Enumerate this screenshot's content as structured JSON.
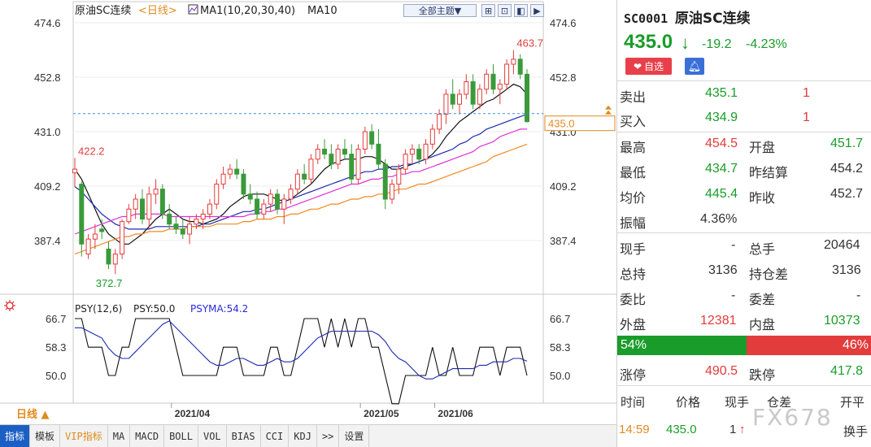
{
  "chart": {
    "title": "原油SC连续",
    "period_tag": "<日线>",
    "ma_legend": "MA1(10,20,30,40)",
    "ma_legend2": "MA10",
    "theme_button": "全部主题▼",
    "price_ticks": [
      "474.6",
      "452.8",
      "431.0",
      "409.2",
      "387.4"
    ],
    "high_annotation": "463.7",
    "low_annotation": "372.7",
    "left_annotation": "422.2",
    "current_price_label": "435.0",
    "date_labels": [
      "2021/04",
      "2021/05",
      "2021/06"
    ],
    "psy_title": "PSY(12,6)",
    "psy_value": "PSY:50.0",
    "psyma_value": "PSYMA:54.2",
    "psy_ticks": [
      "66.7",
      "58.3",
      "50.0"
    ],
    "period_button": "日线 ▲"
  },
  "chart_data": {
    "type": "candlestick",
    "candles": [
      [
        414.5,
        420.5,
        409,
        416
      ],
      [
        410,
        411,
        381,
        386
      ],
      [
        382,
        390,
        380,
        388
      ],
      [
        388,
        394,
        384,
        390
      ],
      [
        392,
        396,
        388,
        391
      ],
      [
        384,
        387,
        376,
        378
      ],
      [
        378,
        384,
        374,
        382
      ],
      [
        382,
        396,
        380,
        395
      ],
      [
        395,
        402,
        394,
        400
      ],
      [
        400,
        406,
        396,
        404
      ],
      [
        404,
        408,
        394,
        396
      ],
      [
        396,
        409,
        392,
        406
      ],
      [
        406,
        412,
        402,
        408
      ],
      [
        408,
        410,
        396,
        398
      ],
      [
        398,
        402,
        392,
        394
      ],
      [
        394,
        397,
        390,
        392
      ],
      [
        392,
        396,
        388,
        390
      ],
      [
        390,
        397,
        386,
        394
      ],
      [
        394,
        398,
        392,
        396
      ],
      [
        396,
        400,
        392,
        398
      ],
      [
        398,
        404,
        396,
        402
      ],
      [
        402,
        412,
        400,
        410
      ],
      [
        410,
        417,
        408,
        414
      ],
      [
        414,
        418,
        412,
        416
      ],
      [
        416,
        420,
        412,
        414
      ],
      [
        414,
        416,
        404,
        406
      ],
      [
        406,
        410,
        402,
        404
      ],
      [
        404,
        407,
        396,
        398
      ],
      [
        398,
        404,
        396,
        402
      ],
      [
        402,
        408,
        399,
        406
      ],
      [
        406,
        408,
        398,
        400
      ],
      [
        400,
        406,
        394,
        404
      ],
      [
        404,
        410,
        402,
        408
      ],
      [
        408,
        416,
        406,
        414
      ],
      [
        414,
        418,
        410,
        412
      ],
      [
        412,
        422,
        410,
        420
      ],
      [
        420,
        426,
        418,
        424
      ],
      [
        424,
        428,
        420,
        422
      ],
      [
        422,
        426,
        416,
        418
      ],
      [
        418,
        426,
        416,
        424
      ],
      [
        424,
        428,
        420,
        422
      ],
      [
        422,
        426,
        410,
        412
      ],
      [
        412,
        426,
        410,
        424
      ],
      [
        424,
        433,
        422,
        431
      ],
      [
        431,
        434,
        424,
        426
      ],
      [
        426,
        432,
        416,
        418
      ],
      [
        418,
        420,
        400,
        404
      ],
      [
        404,
        412,
        402,
        410
      ],
      [
        410,
        418,
        406,
        416
      ],
      [
        416,
        424,
        414,
        422
      ],
      [
        422,
        426,
        418,
        424
      ],
      [
        424,
        426,
        418,
        420
      ],
      [
        420,
        428,
        418,
        426
      ],
      [
        426,
        434,
        424,
        432
      ],
      [
        432,
        440,
        430,
        438
      ],
      [
        438,
        448,
        434,
        446
      ],
      [
        446,
        452,
        440,
        442
      ],
      [
        442,
        448,
        438,
        446
      ],
      [
        446,
        454,
        444,
        451
      ],
      [
        451,
        454,
        440,
        442
      ],
      [
        442,
        450,
        440,
        448
      ],
      [
        448,
        456,
        446,
        454
      ],
      [
        454,
        458,
        446,
        448
      ],
      [
        448,
        452,
        442,
        450
      ],
      [
        450,
        460,
        448,
        458
      ],
      [
        458,
        463.7,
        454,
        460
      ],
      [
        460,
        462,
        452,
        454
      ],
      [
        454,
        456,
        434.7,
        435
      ]
    ],
    "ma_lines": {
      "ma10": [
        416,
        412,
        406,
        400,
        394,
        390,
        388,
        386,
        386,
        388,
        390,
        393,
        396,
        398,
        400,
        398,
        396,
        395,
        395,
        394,
        395,
        396,
        398,
        401,
        403,
        405,
        406,
        406,
        406,
        405,
        404,
        403,
        404,
        406,
        408,
        410,
        413,
        416,
        418,
        419,
        420,
        420,
        420,
        421,
        421,
        420,
        418,
        416,
        416,
        417,
        418,
        419,
        420,
        422,
        425,
        429,
        432,
        435,
        437,
        439,
        441,
        443,
        444,
        446,
        448,
        450,
        449,
        446
      ],
      "ma20": [
        409,
        407,
        404,
        401,
        398,
        396,
        394,
        393,
        392,
        392,
        392,
        392,
        393,
        393,
        393,
        393,
        393,
        393,
        393,
        394,
        394,
        395,
        396,
        397,
        398,
        399,
        399,
        400,
        400,
        401,
        402,
        403,
        404,
        405,
        406,
        407,
        408,
        409,
        410,
        411,
        412,
        413,
        414,
        415,
        415,
        416,
        416,
        417,
        417,
        418,
        418,
        419,
        420,
        421,
        422,
        423,
        424,
        426,
        427,
        429,
        430,
        432,
        433,
        434,
        435,
        436,
        437,
        438
      ],
      "ma30": [
        390,
        391,
        392,
        393,
        394,
        395,
        396,
        397,
        397,
        398,
        398,
        398,
        398,
        398,
        397,
        397,
        397,
        397,
        397,
        397,
        397,
        397,
        397,
        397,
        397,
        397,
        398,
        398,
        399,
        399,
        400,
        400,
        401,
        402,
        403,
        404,
        405,
        406,
        407,
        408,
        409,
        410,
        410,
        411,
        412,
        412,
        413,
        413,
        414,
        414,
        415,
        415,
        416,
        417,
        418,
        419,
        420,
        421,
        422,
        423,
        425,
        426,
        427,
        429,
        430,
        431,
        432,
        432
      ],
      "ma40": [
        382,
        383,
        384,
        385,
        386,
        387,
        388,
        389,
        389,
        390,
        390,
        391,
        391,
        391,
        392,
        392,
        392,
        393,
        393,
        393,
        393,
        394,
        394,
        394,
        394,
        395,
        395,
        396,
        396,
        396,
        397,
        397,
        398,
        398,
        399,
        400,
        400,
        401,
        402,
        402,
        403,
        404,
        404,
        405,
        405,
        406,
        406,
        407,
        408,
        408,
        409,
        410,
        410,
        411,
        412,
        413,
        414,
        415,
        416,
        417,
        418,
        419,
        421,
        422,
        423,
        424,
        425,
        426
      ]
    },
    "ylim": [
      372.7,
      474.6
    ],
    "psy": [
      66.7,
      66.7,
      58.3,
      58.3,
      58.3,
      50,
      50,
      58.3,
      58.3,
      66.7,
      66.7,
      66.7,
      66.7,
      66.7,
      66.7,
      58.3,
      50,
      50,
      50,
      50,
      50,
      50,
      58.3,
      58.3,
      58.3,
      50,
      50,
      50,
      50,
      58.3,
      58.3,
      50,
      50,
      58.3,
      66.7,
      66.7,
      66.7,
      58.3,
      66.7,
      58.3,
      66.7,
      58.3,
      66.7,
      66.7,
      58.3,
      58.3,
      50,
      41.7,
      41.7,
      50,
      50,
      50,
      50,
      58.3,
      50,
      50,
      58.3,
      50,
      50,
      50,
      58.3,
      58.3,
      58.3,
      50,
      58.3,
      58.3,
      58.3,
      50
    ],
    "psyma": [
      64,
      64,
      63,
      62,
      61,
      58,
      56,
      55,
      55,
      57,
      59,
      61,
      63,
      65,
      66,
      64,
      62,
      60,
      58,
      56,
      54,
      53,
      53,
      54,
      55,
      55,
      54,
      53,
      53,
      54,
      55,
      54,
      54,
      55,
      57,
      59,
      61,
      62,
      63,
      63,
      63,
      63,
      63,
      63,
      63,
      62,
      60,
      57,
      55,
      54,
      52,
      50,
      49,
      49,
      50,
      51,
      52,
      52,
      52,
      52,
      53,
      53,
      54,
      54,
      54,
      55,
      55,
      54.2
    ],
    "psy_ylim": [
      41.7,
      66.7
    ]
  },
  "quote": {
    "code": "SC0001",
    "name": "原油SC连续",
    "last": "435.0",
    "arrow": "↓",
    "change": "-19.2",
    "change_pct": "-4.23%",
    "fav_label": "自选",
    "fields": {
      "sell_label": "卖出",
      "sell_price": "435.1",
      "sell_vol": "1",
      "buy_label": "买入",
      "buy_price": "434.9",
      "buy_vol": "1",
      "high_label": "最高",
      "high": "454.5",
      "open_label": "开盘",
      "open": "451.7",
      "low_label": "最低",
      "low": "434.7",
      "presettle_label": "昨结算",
      "presettle": "454.2",
      "avg_label": "均价",
      "avg": "445.4",
      "preclose_label": "昨收",
      "preclose": "452.7",
      "amp_label": "振幅",
      "amp": "4.36%",
      "curvol_label": "现手",
      "curvol": "-",
      "totvol_label": "总手",
      "totvol": "20464",
      "oi_label": "总持",
      "oi": "3136",
      "oichg_label": "持仓差",
      "oichg": "3136",
      "wb_label": "委比",
      "wb": "-",
      "wc_label": "委差",
      "wc": "-",
      "outer_label": "外盘",
      "outer": "12381",
      "inner_label": "内盘",
      "inner": "10373",
      "buy_pct": "54%",
      "sell_pct": "46%",
      "uplimit_label": "涨停",
      "uplimit": "490.5",
      "downlimit_label": "跌停",
      "downlimit": "417.8"
    },
    "tick_headers": [
      "时间",
      "价格",
      "现手",
      "仓差",
      "开平"
    ],
    "tick_row": {
      "time": "14:59",
      "price": "435.0",
      "vol": "1",
      "arrow": "↑",
      "action": "换手"
    },
    "colors": {
      "up": "#e23c3c",
      "down": "#1a9c2a",
      "buy_bar": "#1a9c2a",
      "sell_bar": "#e23c3c"
    }
  },
  "tabs": [
    "指标",
    "模板",
    "VIP指标",
    "MA",
    "MACD",
    "BOLL",
    "VOL",
    "BIAS",
    "CCI",
    "KDJ",
    ">>",
    "设置"
  ],
  "watermark": "FX678"
}
